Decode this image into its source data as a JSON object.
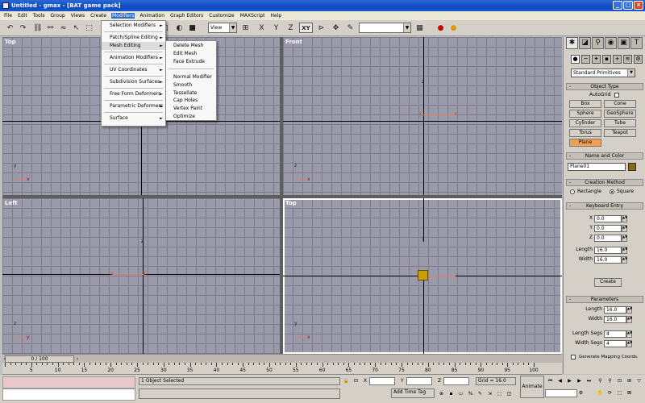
{
  "window": {
    "title": "Untitled - gmax - [BAT game pack]",
    "min": "_",
    "max": "□",
    "close": "×"
  },
  "menubar": {
    "items": [
      "File",
      "Edit",
      "Tools",
      "Group",
      "Views",
      "Create",
      "Modifiers",
      "Animation",
      "Graph Editors",
      "Customize",
      "MAXScript",
      "Help"
    ],
    "active_index": 6
  },
  "toolbar": {
    "view_dropdown": "View",
    "xy_label": "XY",
    "x_label": "X",
    "y_label": "Y",
    "z_label": "Z"
  },
  "modifiers_menu": {
    "items": [
      "Selection Modifiers",
      "Patch/Spline Editing",
      "Mesh Editing",
      "Animation Modifiers",
      "UV Coordinates",
      "Subdivision Surfaces",
      "Free Form Deformers",
      "Parametric Deformers",
      "Surface"
    ],
    "highlighted": "Mesh Editing",
    "submenu_arrow": "►"
  },
  "mesh_editing_submenu": {
    "items": [
      "Delete Mesh",
      "Edit Mesh",
      "Face Extrude",
      "Normal Modifier",
      "Smooth",
      "Tessellate",
      "Cap Holes",
      "Vertex Paint",
      "Optimize"
    ]
  },
  "viewports": {
    "top_left": {
      "label": "Top"
    },
    "top_right": {
      "label": "Front"
    },
    "bottom_left": {
      "label": "Left"
    },
    "bottom_right": {
      "label": "Top"
    },
    "axis_x": "x",
    "axis_y": "y",
    "axis_z": "z"
  },
  "command_panel": {
    "primitive_dropdown": "Standard Primitives",
    "object_type": {
      "header": "Object Type",
      "autogrid_label": "AutoGrid",
      "buttons": [
        "Box",
        "Cone",
        "Sphere",
        "GeoSphere",
        "Cylinder",
        "Tube",
        "Torus",
        "Teapot",
        "Plane"
      ],
      "active": "Plane"
    },
    "name_and_color": {
      "header": "Name and Color",
      "name": "Plane01",
      "color": "#8a6a10"
    },
    "creation_method": {
      "header": "Creation Method",
      "options": [
        "Rectangle",
        "Square"
      ],
      "selected": "Square"
    },
    "keyboard_entry": {
      "header": "Keyboard Entry",
      "x_label": "X",
      "x": "0.0",
      "y_label": "Y",
      "y": "0.0",
      "z_label": "Z",
      "z": "0.0",
      "length_label": "Length",
      "length": "16.0",
      "width_label": "Width",
      "width": "16.0",
      "create_label": "Create"
    },
    "parameters": {
      "header": "Parameters",
      "length_label": "Length",
      "length": "16.0",
      "width_label": "Width",
      "width": "16.0",
      "length_segs_label": "Length Segs",
      "length_segs": "4",
      "width_segs_label": "Width Segs",
      "width_segs": "4",
      "gen_mapping_label": "Generate Mapping Coords."
    },
    "rollout_toggle": "-"
  },
  "timeline": {
    "slider_text": "0 / 100",
    "ticks": [
      "5",
      "10",
      "15",
      "20",
      "25",
      "30",
      "35",
      "40",
      "45",
      "50",
      "55",
      "60",
      "65",
      "70",
      "75",
      "80",
      "85",
      "90",
      "95",
      "100"
    ]
  },
  "status": {
    "selection": "1 Object Selected",
    "x_label": "X",
    "y_label": "Y",
    "z_label": "Z",
    "grid": "Grid = 16.0",
    "add_time_tag": "Add Time Tag",
    "animate": "Animate"
  }
}
